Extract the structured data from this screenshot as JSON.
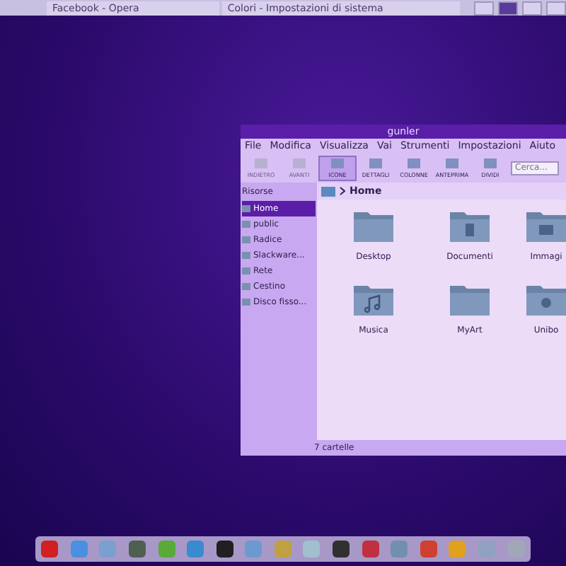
{
  "top_panel": {
    "tasks": [
      {
        "label": "Facebook - Opera",
        "selected": false
      },
      {
        "label": "Colori - Impostazioni di sistema",
        "selected": false
      }
    ],
    "pager": [
      {
        "selected": false
      },
      {
        "selected": true
      },
      {
        "selected": false
      },
      {
        "selected": false
      }
    ]
  },
  "window": {
    "title": "gunler",
    "menu": [
      "File",
      "Modifica",
      "Visualizza",
      "Vai",
      "Strumenti",
      "Impostazioni",
      "Aiuto"
    ],
    "toolbar": [
      {
        "label": "INDIETRO",
        "disabled": true,
        "selected": false
      },
      {
        "label": "AVANTI",
        "disabled": true,
        "selected": false
      },
      {
        "label": "ICONE",
        "disabled": false,
        "selected": true
      },
      {
        "label": "DETTAGLI",
        "disabled": false,
        "selected": false
      },
      {
        "label": "COLONNE",
        "disabled": false,
        "selected": false
      },
      {
        "label": "ANTEPRIMA",
        "disabled": false,
        "selected": false
      },
      {
        "label": "DIVIDI",
        "disabled": false,
        "selected": false
      }
    ],
    "search": {
      "placeholder": "Cerca..."
    },
    "sidebar": {
      "title": "Risorse",
      "items": [
        {
          "label": "Home",
          "selected": true
        },
        {
          "label": "public",
          "selected": false
        },
        {
          "label": "Radice",
          "selected": false
        },
        {
          "label": "Slackware...",
          "selected": false
        },
        {
          "label": "Rete",
          "selected": false
        },
        {
          "label": "Cestino",
          "selected": false
        },
        {
          "label": "Disco fisso...",
          "selected": false
        }
      ]
    },
    "breadcrumb": "Home",
    "files": [
      {
        "name": "Desktop",
        "kind": "plain"
      },
      {
        "name": "Documenti",
        "kind": "documents"
      },
      {
        "name": "Immagi",
        "kind": "pictures"
      },
      {
        "name": "Musica",
        "kind": "music"
      },
      {
        "name": "MyArt",
        "kind": "plain"
      },
      {
        "name": "Unibo",
        "kind": "person"
      }
    ],
    "status_bar": "7 cartelle"
  }
}
